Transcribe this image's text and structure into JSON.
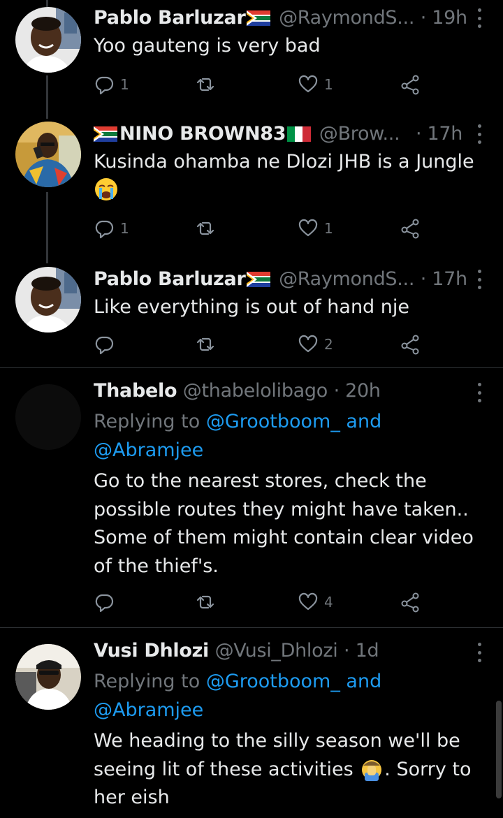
{
  "tweets": [
    {
      "name": "Pablo Barluzar",
      "handle": "@RaymondS...",
      "time": "· 19h",
      "text": "Yoo gauteng is very bad",
      "replies": "1",
      "retweets": "",
      "likes": "1"
    },
    {
      "name": "NINO BROWN83",
      "handle": "@Brow...",
      "time": "· 17h",
      "text": "Kusinda ohamba ne Dlozi JHB is a Jungle",
      "replies": "1",
      "retweets": "",
      "likes": "1"
    },
    {
      "name": "Pablo Barluzar",
      "handle": "@RaymondS...",
      "time": "· 17h",
      "text": "Like everything is out of hand nje",
      "replies": "",
      "retweets": "",
      "likes": "2"
    },
    {
      "name": "Thabelo",
      "handle": "@thabelolibago",
      "time": "· 20h",
      "reply_prefix": "Replying to",
      "reply_user1": "@Grootboom_ and",
      "reply_user2": "@Abramjee",
      "text": "Go to the nearest stores, check the possible routes they might have taken.. Some of them might contain clear video of the thief's.",
      "replies": "",
      "retweets": "",
      "likes": "4"
    },
    {
      "name": "Vusi Dhlozi",
      "handle": "@Vusi_Dhlozi",
      "time": "· 1d",
      "reply_prefix": "Replying to",
      "reply_user1": "@Grootboom_ and",
      "reply_user2": "@Abramjee",
      "text_line1": "We heading to the silly season we'll be",
      "text_line2a": "seeing lit of these activities",
      "text_line2b": ". Sorry to",
      "text_line3": "her eish"
    }
  ],
  "colors": {
    "background": "#000000",
    "text": "#e7e9ea",
    "secondary": "#71767b",
    "link": "#1d9bf0",
    "divider": "#2f3336"
  },
  "icons": [
    "reply-icon",
    "retweet-icon",
    "like-icon",
    "share-icon",
    "more-icon",
    "south-africa-flag-icon",
    "italy-flag-icon",
    "crying-face-emoji",
    "facepalm-emoji"
  ]
}
